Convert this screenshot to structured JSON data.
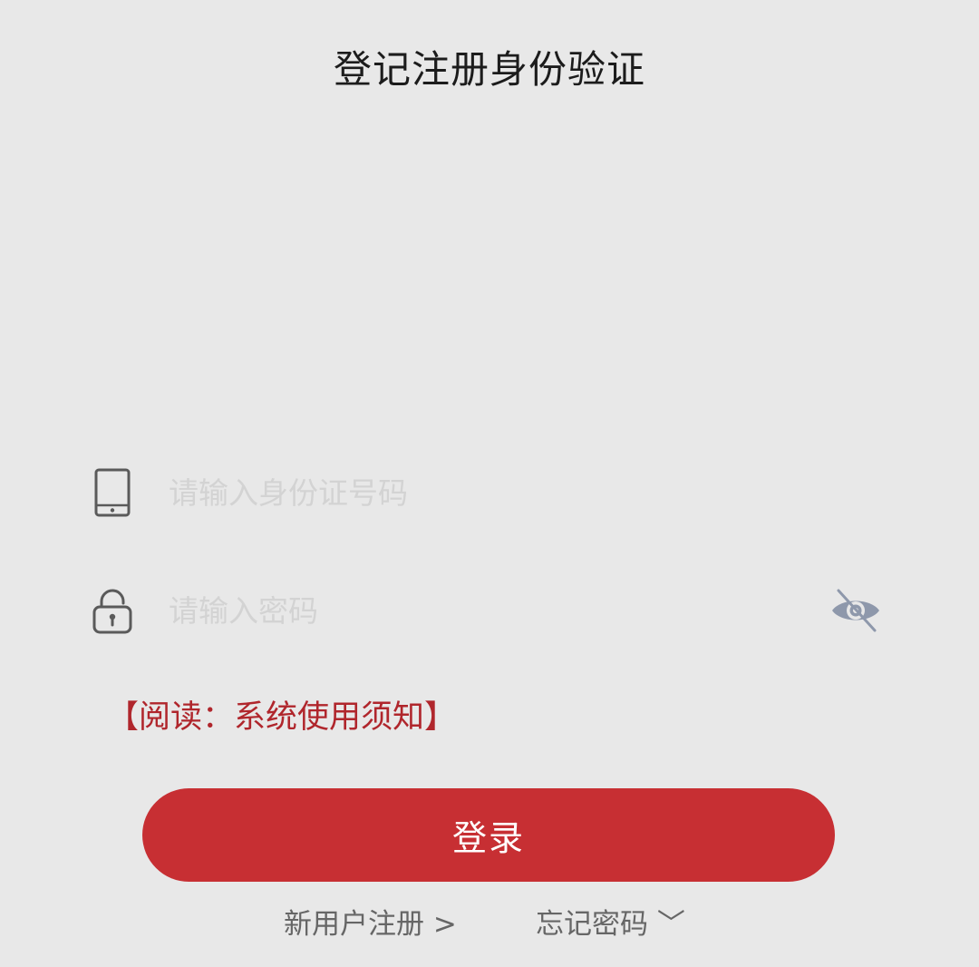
{
  "header": {
    "title": "登记注册身份验证"
  },
  "form": {
    "id_field": {
      "placeholder": "请输入身份证号码",
      "value": "",
      "icon": "tablet-icon"
    },
    "password_field": {
      "placeholder": "请输入密码",
      "value": "",
      "icon": "unlock-icon",
      "visibility_toggle_icon": "eye-slash-icon"
    },
    "notice_link": "【阅读：系统使用须知】",
    "login_button": "登录"
  },
  "footer": {
    "register_link": "新用户注册 >",
    "forgot_link": "忘记密码 ﹀"
  },
  "colors": {
    "background": "#e8e8e8",
    "primary": "#c72f33",
    "notice_text": "#b0262c",
    "muted_text": "#666666"
  }
}
